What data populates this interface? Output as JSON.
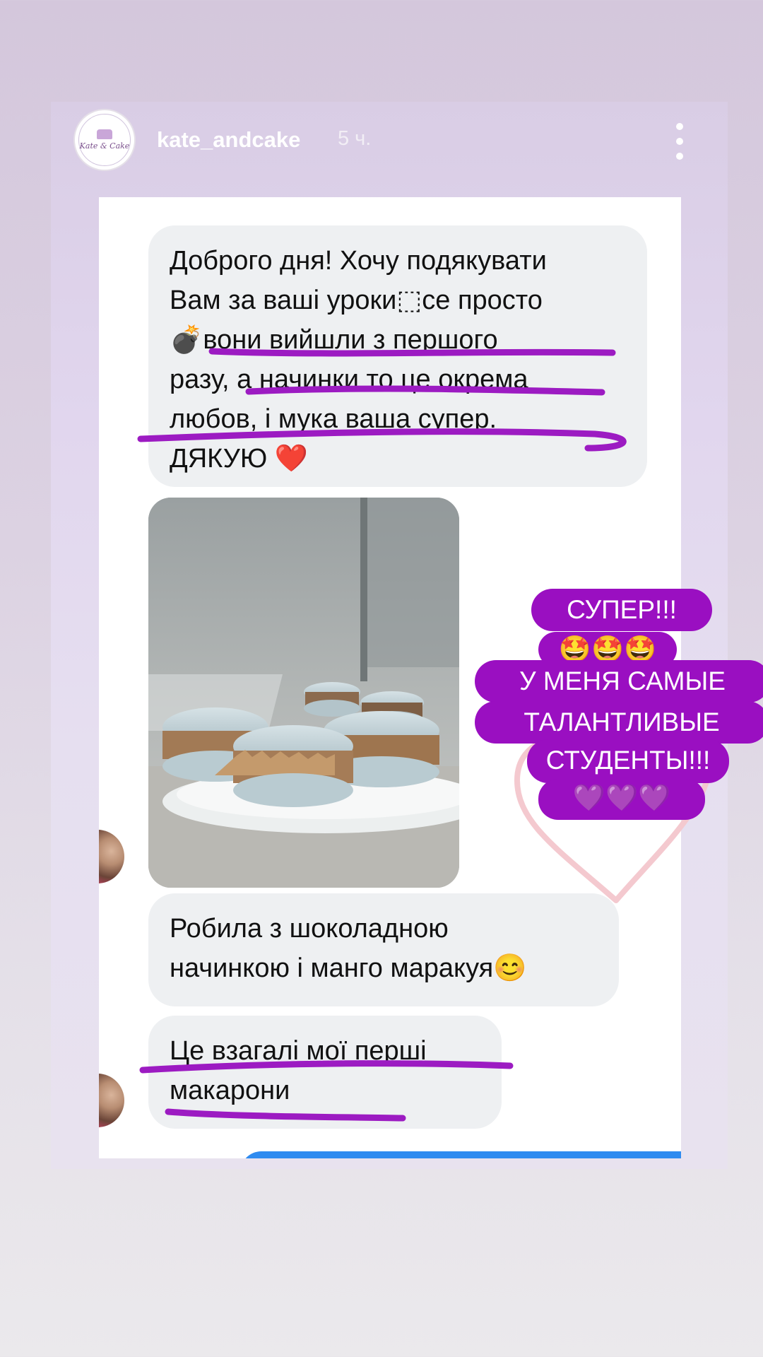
{
  "header": {
    "username": "kate_andcake",
    "time": "5 ч.",
    "logo_text": "Kate & Cake"
  },
  "messages": [
    {
      "lines": [
        "Доброго дня! Хочу подякувати",
        "Вам за ваші уроки⬚ce просто",
        "💣вони вийшли з першого",
        "разу, а начинки то це окрема",
        "любов, і мука ваша супер.",
        "ДЯКУЮ ❤️"
      ]
    },
    {
      "lines": [
        "Робила з шоколадною",
        "начинкою і манго маракуя😊"
      ]
    },
    {
      "lines": [
        "Це взагалі мої перші",
        "макарони"
      ]
    }
  ],
  "sticker": {
    "lines": [
      "СУПЕР!!!",
      "🤩🤩🤩",
      "У МЕНЯ САМЫЕ",
      "ТАЛАНТЛИВЫЕ",
      "СТУДЕНТЫ!!!",
      "💜💜💜"
    ]
  },
  "colors": {
    "sticker_bg": "#9a0fc1",
    "underline": "#9c1bc2",
    "heart_outline": "#f4c9cf",
    "bubble_bg": "#eef0f2"
  }
}
